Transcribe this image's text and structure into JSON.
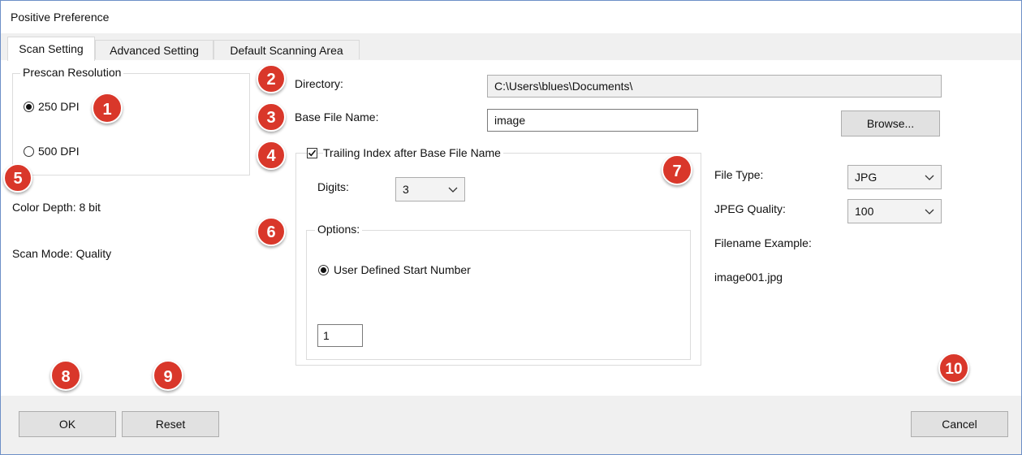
{
  "window": {
    "title": "Positive Preference"
  },
  "tabs": [
    {
      "label": "Scan Setting"
    },
    {
      "label": "Advanced Setting"
    },
    {
      "label": "Default Scanning Area"
    }
  ],
  "prescan": {
    "legend": "Prescan Resolution",
    "options": [
      {
        "label": "250 DPI",
        "selected": true
      },
      {
        "label": "500 DPI",
        "selected": false
      }
    ]
  },
  "info": {
    "color_depth": "Color Depth: 8 bit",
    "scan_mode": "Scan Mode: Quality"
  },
  "directory": {
    "label": "Directory:",
    "value": "C:\\Users\\blues\\Documents\\"
  },
  "base_file": {
    "label": "Base File Name:",
    "value": "image",
    "browse_label": "Browse..."
  },
  "trailing": {
    "label": "Trailing Index after Base File Name",
    "checked": true,
    "digits_label": "Digits:",
    "digits_value": "3",
    "options_legend": "Options:",
    "start_label": "User Defined Start Number",
    "start_value": "1"
  },
  "file": {
    "type_label": "File Type:",
    "type_value": "JPG",
    "quality_label": "JPEG Quality:",
    "quality_value": "100",
    "example_label": "Filename Example:",
    "example_value": "image001.jpg"
  },
  "footer": {
    "ok_label": "OK",
    "reset_label": "Reset",
    "cancel_label": "Cancel"
  },
  "badges": [
    "1",
    "2",
    "3",
    "4",
    "5",
    "6",
    "7",
    "8",
    "9",
    "10"
  ],
  "colors": {
    "badge": "#d9372a",
    "window_border": "#6d8fc7"
  }
}
